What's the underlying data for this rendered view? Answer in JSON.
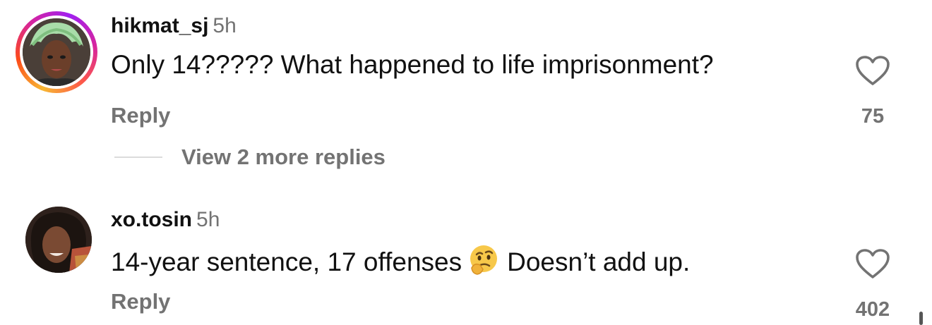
{
  "comments": [
    {
      "username": "hikmat_sj",
      "time": "5h",
      "text": "Only 14????? What happened to life imprisonment?",
      "reply_label": "Reply",
      "likes": "75",
      "view_more": "View 2 more replies",
      "has_story_ring": true
    },
    {
      "username": "xo.tosin",
      "time": "5h",
      "text_before_emoji": "14-year sentence, 17 offenses",
      "emoji": "thinking-face",
      "text_after_emoji": "Doesn’t add up.",
      "reply_label": "Reply",
      "likes": "402",
      "has_story_ring": false
    }
  ],
  "colors": {
    "primary_text": "#111111",
    "secondary_text": "#737373",
    "divider": "#dbdbdb",
    "background": "#ffffff"
  },
  "icons": {
    "like": "heart-outline-icon",
    "emoji": "thinking-face-emoji"
  }
}
